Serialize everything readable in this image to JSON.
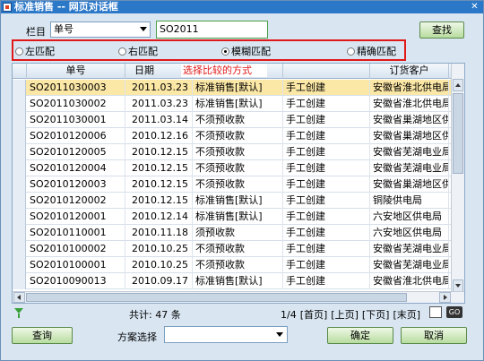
{
  "window": {
    "title": "标准销售 -- 网页对话框",
    "close_label": "✕"
  },
  "search": {
    "column_label": "栏目",
    "column_selected": "单号",
    "keyword": "SO2011",
    "find_button": "查找"
  },
  "match_modes": [
    {
      "label": "左匹配",
      "checked": false
    },
    {
      "label": "右匹配",
      "checked": false
    },
    {
      "label": "模糊匹配",
      "checked": true
    },
    {
      "label": "精确匹配",
      "checked": false
    }
  ],
  "tooltip": "选择比较的方式",
  "table": {
    "headers": [
      "单号",
      "日期",
      "",
      "",
      "订货客户"
    ],
    "rows": [
      [
        "SO2011030003",
        "2011.03.23",
        "标准销售[默认]",
        "手工创建",
        "安徽省淮北供电局"
      ],
      [
        "SO2011030002",
        "2011.03.23",
        "标准销售[默认]",
        "手工创建",
        "安徽省淮北供电局"
      ],
      [
        "SO2011030001",
        "2011.03.14",
        "不须预收款",
        "手工创建",
        "安徽省巢湖地区供..."
      ],
      [
        "SO2010120006",
        "2010.12.16",
        "不须预收款",
        "手工创建",
        "安徽省巢湖地区供..."
      ],
      [
        "SO2010120005",
        "2010.12.15",
        "不须预收款",
        "手工创建",
        "安徽省芜湖电业局"
      ],
      [
        "SO2010120004",
        "2010.12.15",
        "不须预收款",
        "手工创建",
        "安徽省芜湖电业局"
      ],
      [
        "SO2010120003",
        "2010.12.15",
        "不须预收款",
        "手工创建",
        "安徽省巢湖地区供..."
      ],
      [
        "SO2010120002",
        "2010.12.15",
        "标准销售[默认]",
        "手工创建",
        "铜陵供电局"
      ],
      [
        "SO2010120001",
        "2010.12.14",
        "标准销售[默认]",
        "手工创建",
        "六安地区供电局"
      ],
      [
        "SO2010110001",
        "2010.11.18",
        "须预收款",
        "手工创建",
        "六安地区供电局"
      ],
      [
        "SO2010100002",
        "2010.10.25",
        "不须预收款",
        "手工创建",
        "安徽省芜湖电业局"
      ],
      [
        "SO2010100001",
        "2010.10.25",
        "不须预收款",
        "手工创建",
        "安徽省芜湖电业局"
      ],
      [
        "SO2010090013",
        "2010.09.17",
        "标准销售[默认]",
        "手工创建",
        "安徽省淮北供电局"
      ]
    ]
  },
  "footer": {
    "total": "共计: 47 条",
    "page_info": "1/4",
    "first": "[首页]",
    "prev": "[上页]",
    "next": "[下页]",
    "last": "[末页]",
    "go": "GO"
  },
  "bottom": {
    "query_button": "查询",
    "plan_label": "方案选择",
    "plan_selected": "",
    "ok_button": "确定",
    "cancel_button": "取消"
  }
}
